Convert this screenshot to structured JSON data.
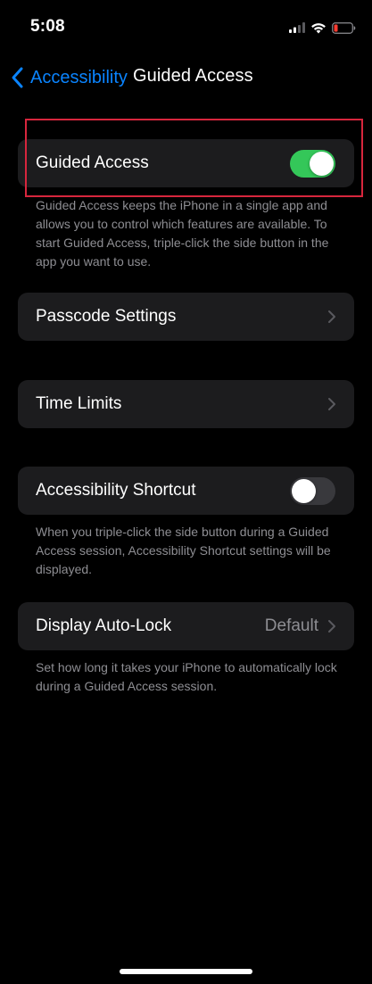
{
  "status_bar": {
    "time": "5:08",
    "battery_color": "#ff3b30"
  },
  "nav": {
    "back_label": "Accessibility",
    "title": "Guided Access"
  },
  "guided_access": {
    "label": "Guided Access",
    "toggle_on": true,
    "footer": "Guided Access keeps the iPhone in a single app and allows you to control which features are available. To start Guided Access, triple-click the side button in the app you want to use."
  },
  "passcode_settings": {
    "label": "Passcode Settings"
  },
  "time_limits": {
    "label": "Time Limits"
  },
  "accessibility_shortcut": {
    "label": "Accessibility Shortcut",
    "toggle_on": false,
    "footer": "When you triple-click the side button during a Guided Access session, Accessibility Shortcut settings will be displayed."
  },
  "display_auto_lock": {
    "label": "Display Auto-Lock",
    "value": "Default",
    "footer": "Set how long it takes your iPhone to automatically lock during a Guided Access session."
  },
  "colors": {
    "accent": "#0a84ff",
    "toggle_on": "#34c759",
    "highlight": "#d7263d"
  }
}
